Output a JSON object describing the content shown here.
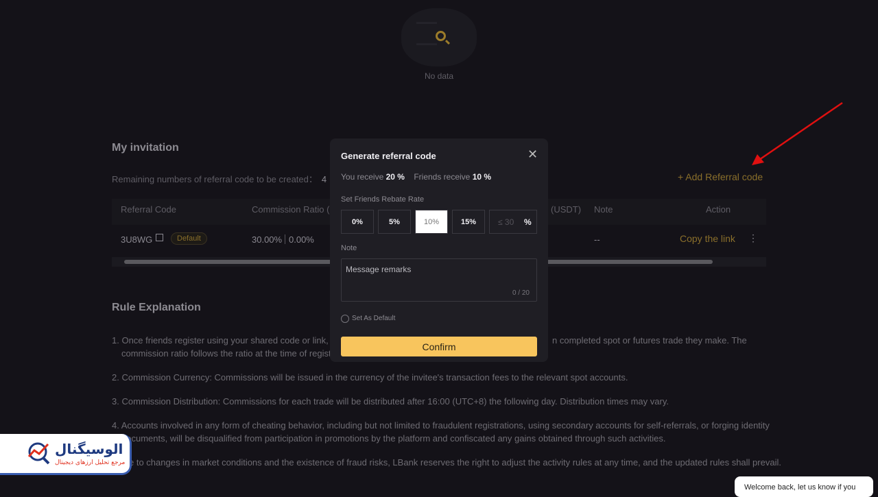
{
  "empty": {
    "text": "No data"
  },
  "invitation": {
    "title": "My invitation",
    "remaining_label": "Remaining numbers of referral code to be created：",
    "remaining_count": "4",
    "add_button": "+ Add Referral code",
    "columns": [
      "Referral Code",
      "Commission Ratio (M",
      "(USDT)",
      "Note",
      "Action"
    ],
    "rows": [
      {
        "code": "3U8WG",
        "badge": "Default",
        "ratio": "30.00%",
        "ratio2": "0.00%",
        "note": "--",
        "action": "Copy the link"
      }
    ]
  },
  "rules": {
    "title": "Rule Explanation",
    "items": [
      "1. Once friends register using your shared code or link, b",
      "n completed spot or futures trade they make. The",
      "commission ratio follows the ratio at the time of regist",
      "2. Commission Currency: Commissions will be issued in the currency of the invitee's transaction fees to the relevant spot accounts.",
      "3. Commission Distribution: Commissions for each trade will be distributed after 16:00 (UTC+8) the following day. Distribution times may vary.",
      "4. Accounts involved in any form of cheating behavior, including but not limited to fraudulent registrations, using secondary accounts for self-referrals, or forging identity",
      "documents, will be disqualified from participation in promotions by the platform and confiscated any gains obtained through such activities.",
      "e to changes in market conditions and the existence of fraud risks, LBank reserves the right to adjust the activity rules at any time, and the updated rules shall prevail."
    ]
  },
  "modal": {
    "title": "Generate referral code",
    "you_receive_label": "You receive",
    "you_receive": "20 %",
    "friends_receive_label": "Friends receive",
    "friends_receive": "10 %",
    "rate_label": "Set Friends Rebate Rate",
    "options": [
      "0%",
      "5%",
      "10%",
      "15%"
    ],
    "selected": "10%",
    "custom_placeholder": "≤ 30",
    "custom_unit": "%",
    "note_label": "Note",
    "note_placeholder": "Message remarks",
    "note_counter": "0 / 20",
    "default_label": "Set As Default",
    "confirm": "Confirm"
  },
  "logo": {
    "text": "الوسیگنال",
    "subtitle": "مرجع تحلیل ارزهای دیجیتال"
  },
  "chat": {
    "text": "Welcome back, let us know if you"
  },
  "colors": {
    "accent": "#f8c55d",
    "background": "#141218",
    "annotation_arrow": "#e01010"
  }
}
